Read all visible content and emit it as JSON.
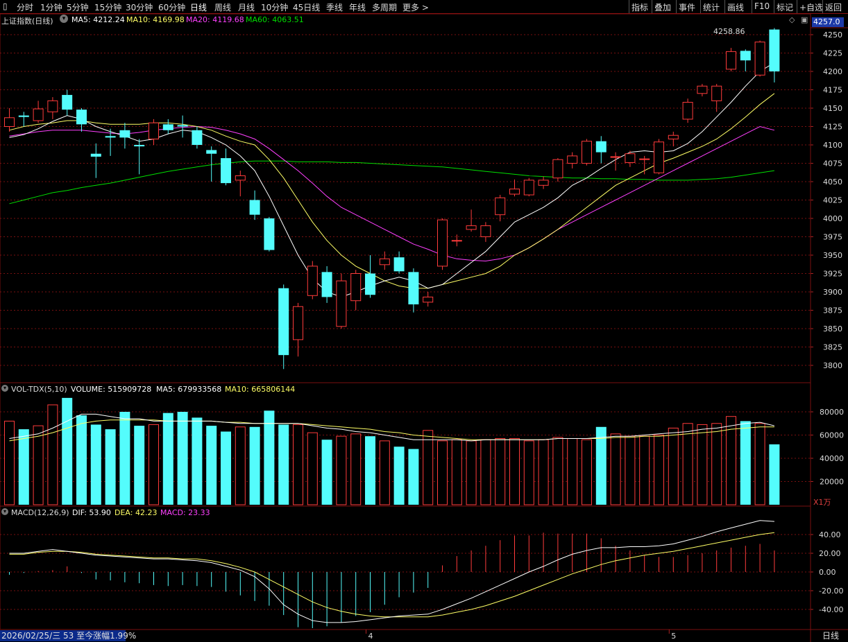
{
  "toolbar": {
    "left_items": [
      "分时",
      "1分钟",
      "5分钟",
      "15分钟",
      "30分钟",
      "60分钟",
      "日线",
      "周线",
      "月线",
      "10分钟",
      "45日线",
      "季线",
      "年线",
      "多周期",
      "更多 >"
    ],
    "active": "日线",
    "right_items": [
      "指标",
      "叠加",
      "事件",
      "统计",
      "画线",
      "F10",
      "标记",
      "+自选",
      "返回"
    ]
  },
  "header": {
    "title": "上证指数(日线)",
    "ma5": "MA5: 4212.24",
    "ma10": "MA10: 4169.98",
    "ma20": "MA20: 4119.68",
    "ma60": "MA60: 4063.51"
  },
  "volume_header": {
    "name": "VOL-TDX(5,10)",
    "volume": "VOLUME: 515909728",
    "ma5": "MA5: 679933568",
    "ma10": "MA10: 665806144"
  },
  "macd_header": {
    "name": "MACD(12,26,9)",
    "dif": "DIF: 53.90",
    "dea": "DEA: 42.23",
    "macd": "MACD: 23.33"
  },
  "current_price": "4257.0",
  "high_marker": "4258.86",
  "volume_unit": "X1万",
  "status_bar": "2026/02/25/三 53 至今涨幅1.99%",
  "period_tag": "日线",
  "colors": {
    "up": "#ff3b3b",
    "down": "#54fcfc",
    "ma5": "#ffffff",
    "ma10": "#ffff66",
    "ma20": "#ff40ff",
    "ma60": "#00e000",
    "grid": "#7a1010"
  },
  "chart_data": {
    "type": "candlestick",
    "y_ticks": [
      4250,
      4225,
      4200,
      4175,
      4150,
      4125,
      4100,
      4075,
      4050,
      4025,
      4000,
      3975,
      3950,
      3925,
      3900,
      3875,
      3850,
      3825,
      3800
    ],
    "x_labels": [
      {
        "index": 25,
        "label": "4"
      },
      {
        "index": 46,
        "label": "5"
      }
    ],
    "candles": [
      {
        "o": 4125,
        "c": 4137,
        "h": 4150,
        "l": 4118
      },
      {
        "o": 4140,
        "c": 4138,
        "h": 4145,
        "l": 4125
      },
      {
        "o": 4133,
        "c": 4149,
        "h": 4160,
        "l": 4130
      },
      {
        "o": 4145,
        "c": 4160,
        "h": 4165,
        "l": 4135
      },
      {
        "o": 4168,
        "c": 4148,
        "h": 4175,
        "l": 4140
      },
      {
        "o": 4148,
        "c": 4128,
        "h": 4150,
        "l": 4118
      },
      {
        "o": 4088,
        "c": 4084,
        "h": 4102,
        "l": 4055
      },
      {
        "o": 4112,
        "c": 4110,
        "h": 4122,
        "l": 4085
      },
      {
        "o": 4120,
        "c": 4110,
        "h": 4130,
        "l": 4095
      },
      {
        "o": 4100,
        "c": 4098,
        "h": 4108,
        "l": 4060
      },
      {
        "o": 4108,
        "c": 4130,
        "h": 4135,
        "l": 4100
      },
      {
        "o": 4128,
        "c": 4120,
        "h": 4135,
        "l": 4115
      },
      {
        "o": 4127,
        "c": 4125,
        "h": 4140,
        "l": 4110
      },
      {
        "o": 4120,
        "c": 4100,
        "h": 4125,
        "l": 4095
      },
      {
        "o": 4093,
        "c": 4088,
        "h": 4098,
        "l": 4050
      },
      {
        "o": 4082,
        "c": 4048,
        "h": 4095,
        "l": 4045
      },
      {
        "o": 4052,
        "c": 4058,
        "h": 4065,
        "l": 4030
      },
      {
        "o": 4025,
        "c": 4005,
        "h": 4038,
        "l": 3998
      },
      {
        "o": 4000,
        "c": 3957,
        "h": 4002,
        "l": 3955
      },
      {
        "o": 3905,
        "c": 3814,
        "h": 3910,
        "l": 3795
      },
      {
        "o": 3835,
        "c": 3880,
        "h": 3885,
        "l": 3812
      },
      {
        "o": 3895,
        "c": 3935,
        "h": 3942,
        "l": 3890
      },
      {
        "o": 3927,
        "c": 3893,
        "h": 3935,
        "l": 3885
      },
      {
        "o": 3853,
        "c": 3915,
        "h": 3925,
        "l": 3850
      },
      {
        "o": 3888,
        "c": 3925,
        "h": 3930,
        "l": 3875
      },
      {
        "o": 3925,
        "c": 3896,
        "h": 3950,
        "l": 3892
      },
      {
        "o": 3937,
        "c": 3945,
        "h": 3955,
        "l": 3930
      },
      {
        "o": 3947,
        "c": 3928,
        "h": 3955,
        "l": 3925
      },
      {
        "o": 3927,
        "c": 3883,
        "h": 3932,
        "l": 3872
      },
      {
        "o": 3886,
        "c": 3893,
        "h": 3900,
        "l": 3880
      },
      {
        "o": 3935,
        "c": 3998,
        "h": 4000,
        "l": 3930
      },
      {
        "o": 3970,
        "c": 3970,
        "h": 3978,
        "l": 3962
      },
      {
        "o": 3985,
        "c": 3990,
        "h": 4012,
        "l": 3982
      },
      {
        "o": 3975,
        "c": 3990,
        "h": 3995,
        "l": 3968
      },
      {
        "o": 4005,
        "c": 4028,
        "h": 4032,
        "l": 3996
      },
      {
        "o": 4033,
        "c": 4040,
        "h": 4053,
        "l": 4030
      },
      {
        "o": 4032,
        "c": 4052,
        "h": 4055,
        "l": 4030
      },
      {
        "o": 4045,
        "c": 4052,
        "h": 4057,
        "l": 4040
      },
      {
        "o": 4055,
        "c": 4080,
        "h": 4082,
        "l": 4050
      },
      {
        "o": 4075,
        "c": 4085,
        "h": 4090,
        "l": 4068
      },
      {
        "o": 4075,
        "c": 4105,
        "h": 4108,
        "l": 4072
      },
      {
        "o": 4105,
        "c": 4090,
        "h": 4112,
        "l": 4075
      },
      {
        "o": 4083,
        "c": 4084,
        "h": 4090,
        "l": 4065
      },
      {
        "o": 4076,
        "c": 4088,
        "h": 4092,
        "l": 4070
      },
      {
        "o": 4080,
        "c": 4081,
        "h": 4085,
        "l": 4060
      },
      {
        "o": 4062,
        "c": 4104,
        "h": 4108,
        "l": 4060
      },
      {
        "o": 4108,
        "c": 4113,
        "h": 4118,
        "l": 4098
      },
      {
        "o": 4135,
        "c": 4158,
        "h": 4163,
        "l": 4130
      },
      {
        "o": 4170,
        "c": 4180,
        "h": 4183,
        "l": 4166
      },
      {
        "o": 4160,
        "c": 4180,
        "h": 4183,
        "l": 4145
      },
      {
        "o": 4203,
        "c": 4227,
        "h": 4232,
        "l": 4200
      },
      {
        "o": 4228,
        "c": 4215,
        "h": 4230,
        "l": 4200
      },
      {
        "o": 4195,
        "c": 4240,
        "h": 4242,
        "l": 4193
      },
      {
        "o": 4257,
        "c": 4200,
        "h": 4259,
        "l": 4185
      }
    ],
    "ma5": [
      4110,
      4114,
      4122,
      4132,
      4140,
      4135,
      4125,
      4118,
      4112,
      4105,
      4108,
      4115,
      4120,
      4118,
      4110,
      4100,
      4085,
      4065,
      4030,
      3990,
      3950,
      3918,
      3900,
      3893,
      3900,
      3908,
      3915,
      3920,
      3915,
      3905,
      3910,
      3925,
      3940,
      3955,
      3975,
      3995,
      4005,
      4015,
      4028,
      4045,
      4055,
      4068,
      4080,
      4090,
      4092,
      4090,
      4092,
      4102,
      4118,
      4138,
      4158,
      4180,
      4200,
      4212
    ],
    "ma10": [
      4120,
      4125,
      4128,
      4130,
      4133,
      4133,
      4130,
      4128,
      4128,
      4128,
      4130,
      4130,
      4128,
      4125,
      4120,
      4112,
      4105,
      4100,
      4080,
      4055,
      4025,
      3995,
      3970,
      3950,
      3935,
      3925,
      3915,
      3908,
      3905,
      3905,
      3910,
      3915,
      3920,
      3925,
      3935,
      3950,
      3960,
      3972,
      3985,
      4000,
      4015,
      4030,
      4045,
      4055,
      4065,
      4075,
      4082,
      4090,
      4098,
      4108,
      4122,
      4138,
      4155,
      4170
    ],
    "ma20": [
      4112,
      4115,
      4118,
      4120,
      4120,
      4120,
      4118,
      4116,
      4115,
      4117,
      4120,
      4122,
      4124,
      4125,
      4124,
      4120,
      4115,
      4108,
      4095,
      4080,
      4065,
      4048,
      4030,
      4015,
      4005,
      3995,
      3985,
      3975,
      3965,
      3958,
      3950,
      3945,
      3943,
      3942,
      3945,
      3950,
      3960,
      3972,
      3985,
      3995,
      4005,
      4015,
      4025,
      4035,
      4045,
      4055,
      4065,
      4075,
      4085,
      4095,
      4105,
      4115,
      4125,
      4120
    ],
    "ma60": [
      4020,
      4025,
      4030,
      4035,
      4038,
      4042,
      4045,
      4048,
      4052,
      4056,
      4060,
      4064,
      4067,
      4070,
      4073,
      4075,
      4077,
      4078,
      4078,
      4078,
      4077,
      4077,
      4077,
      4076,
      4076,
      4075,
      4074,
      4073,
      4072,
      4071,
      4070,
      4068,
      4066,
      4064,
      4062,
      4060,
      4058,
      4057,
      4056,
      4055,
      4055,
      4054,
      4054,
      4053,
      4053,
      4052,
      4052,
      4052,
      4053,
      4054,
      4056,
      4059,
      4062,
      4065
    ],
    "volume": {
      "y_ticks": [
        80000,
        60000,
        40000,
        20000
      ],
      "values": [
        72000,
        65000,
        68000,
        86000,
        92000,
        77000,
        69000,
        65000,
        80000,
        68000,
        69000,
        79000,
        80000,
        75000,
        68000,
        63000,
        67000,
        67000,
        81000,
        69000,
        69000,
        62000,
        56000,
        59000,
        61000,
        59000,
        55000,
        50000,
        48000,
        64000,
        55000,
        56000,
        55000,
        56000,
        57000,
        57000,
        55000,
        56000,
        58000,
        57000,
        56000,
        67000,
        61000,
        59000,
        59000,
        60000,
        66000,
        70000,
        69000,
        70000,
        76000,
        72000,
        70000,
        52000
      ],
      "ma5": [
        57000,
        59000,
        61000,
        66000,
        72000,
        78000,
        78000,
        76000,
        74000,
        74000,
        72000,
        72000,
        72000,
        72000,
        72000,
        71000,
        70000,
        70000,
        70000,
        70000,
        70000,
        68000,
        66000,
        65000,
        63000,
        62000,
        60000,
        58000,
        56000,
        56000,
        56000,
        56000,
        55000,
        56000,
        56000,
        56000,
        56000,
        56000,
        57000,
        57000,
        57000,
        58000,
        59000,
        59000,
        60000,
        61000,
        62000,
        63000,
        65000,
        66000,
        68000,
        70000,
        71000,
        68000
      ],
      "ma10": [
        55000,
        57000,
        59000,
        62000,
        66000,
        70000,
        72000,
        73000,
        73000,
        73000,
        73000,
        72000,
        72000,
        72000,
        72000,
        71000,
        71000,
        70000,
        70000,
        70000,
        70000,
        69000,
        68000,
        67000,
        66000,
        65000,
        63000,
        62000,
        60000,
        59000,
        58000,
        57000,
        56000,
        56000,
        56000,
        56000,
        56000,
        56000,
        57000,
        57000,
        57000,
        57000,
        58000,
        58000,
        59000,
        59000,
        60000,
        61000,
        62000,
        63000,
        65000,
        66000,
        67000,
        67000
      ]
    },
    "macd": {
      "y_ticks": [
        40,
        20,
        0,
        -20,
        -40
      ],
      "dif": [
        20,
        20,
        22,
        24,
        22,
        20,
        18,
        17,
        16,
        15,
        14,
        14,
        13,
        12,
        10,
        6,
        2,
        -5,
        -18,
        -35,
        -45,
        -52,
        -54,
        -54,
        -53,
        -51,
        -49,
        -47,
        -46,
        -45,
        -40,
        -34,
        -28,
        -21,
        -14,
        -7,
        0,
        6,
        13,
        19,
        23,
        26,
        26,
        27,
        27,
        28,
        30,
        34,
        38,
        43,
        47,
        51,
        55,
        54
      ],
      "dea": [
        19,
        19,
        21,
        22,
        22,
        21,
        19,
        18,
        17,
        16,
        15,
        15,
        14,
        14,
        12,
        9,
        5,
        0,
        -8,
        -16,
        -24,
        -32,
        -38,
        -42,
        -45,
        -47,
        -48,
        -48,
        -48,
        -48,
        -46,
        -43,
        -40,
        -36,
        -31,
        -26,
        -20,
        -14,
        -8,
        -2,
        3,
        8,
        12,
        15,
        18,
        20,
        22,
        25,
        28,
        31,
        34,
        37,
        40,
        42
      ],
      "hist": [
        -3,
        -1,
        1,
        2,
        6,
        -1,
        -8,
        -9,
        -11,
        -12,
        -14,
        -15,
        -14,
        -15,
        -16,
        -21,
        -25,
        -31,
        -36,
        -46,
        -59,
        -60,
        -58,
        -54,
        -47,
        -43,
        -35,
        -27,
        -22,
        -17,
        7,
        17,
        23,
        28,
        34,
        39,
        39,
        42,
        41,
        41,
        41,
        36,
        28,
        23,
        18,
        16,
        16,
        18,
        20,
        23,
        26,
        28,
        30,
        23
      ]
    }
  }
}
